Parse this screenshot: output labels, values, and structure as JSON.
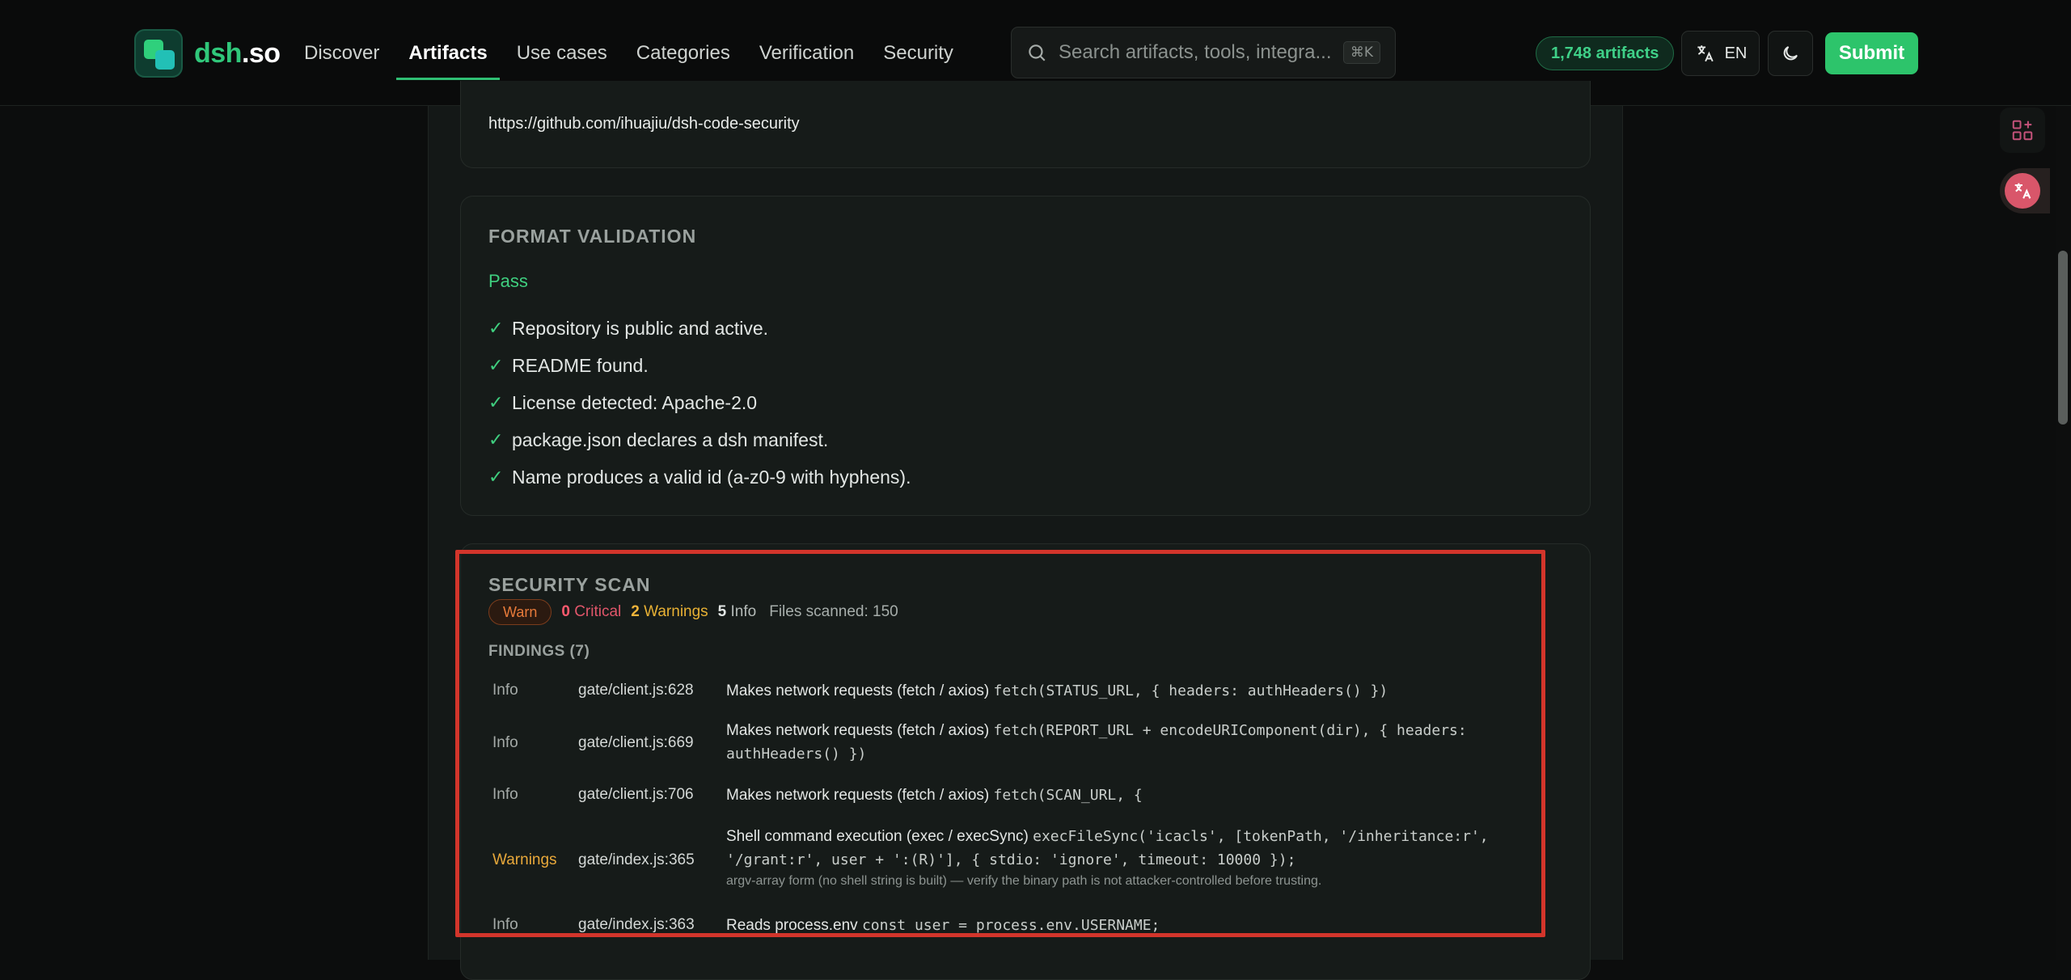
{
  "header": {
    "logo_text": "dsh",
    "logo_suffix": ".so",
    "nav": [
      "Discover",
      "Artifacts",
      "Use cases",
      "Categories",
      "Verification",
      "Security"
    ],
    "active_nav": "Artifacts",
    "search_placeholder": "Search artifacts, tools, integra...",
    "search_shortcut": "⌘K",
    "artifact_count": "1,748 artifacts",
    "language": "EN",
    "submit_label": "Submit"
  },
  "repo": {
    "url": "https://github.com/ihuajiu/dsh-code-security"
  },
  "format_validation": {
    "title": "FORMAT VALIDATION",
    "status": "Pass",
    "checks": [
      "Repository is public and active.",
      "README found.",
      "License detected: Apache-2.0",
      "package.json declares a dsh manifest.",
      "Name produces a valid id (a-z0-9 with hyphens)."
    ]
  },
  "security_scan": {
    "title": "SECURITY SCAN",
    "status": "Warn",
    "critical_count": "0",
    "critical_label": "Critical",
    "warnings_count": "2",
    "warnings_label": "Warnings",
    "info_count": "5",
    "info_label": "Info",
    "files_scanned": "Files scanned: 150",
    "findings_title": "FINDINGS (7)",
    "findings": [
      {
        "severity": "Info",
        "file": "gate/client.js:628",
        "description": "Makes network requests (fetch / axios)",
        "code": "fetch(STATUS_URL, { headers: authHeaders() })",
        "note": ""
      },
      {
        "severity": "Info",
        "file": "gate/client.js:669",
        "description": "Makes network requests (fetch / axios)",
        "code": "fetch(REPORT_URL + encodeURIComponent(dir), { headers: authHeaders() })",
        "note": ""
      },
      {
        "severity": "Info",
        "file": "gate/client.js:706",
        "description": "Makes network requests (fetch / axios)",
        "code": "fetch(SCAN_URL, {",
        "note": ""
      },
      {
        "severity": "Warnings",
        "file": "gate/index.js:365",
        "description": "Shell command execution (exec / execSync)",
        "code": "execFileSync('icacls', [tokenPath, '/inheritance:r', '/grant:r', user + ':(R)'], { stdio: 'ignore', timeout: 10000 });",
        "note": "argv-array form (no shell string is built) — verify the binary path is not attacker-controlled before trusting."
      },
      {
        "severity": "Info",
        "file": "gate/index.js:363",
        "description": "Reads process.env",
        "code": "const user = process.env.USERNAME;",
        "note": ""
      }
    ]
  },
  "colors": {
    "accent": "#2dc46b",
    "warn": "#e8a83a",
    "critical": "#ff5a6e",
    "highlight": "#d3352b"
  }
}
